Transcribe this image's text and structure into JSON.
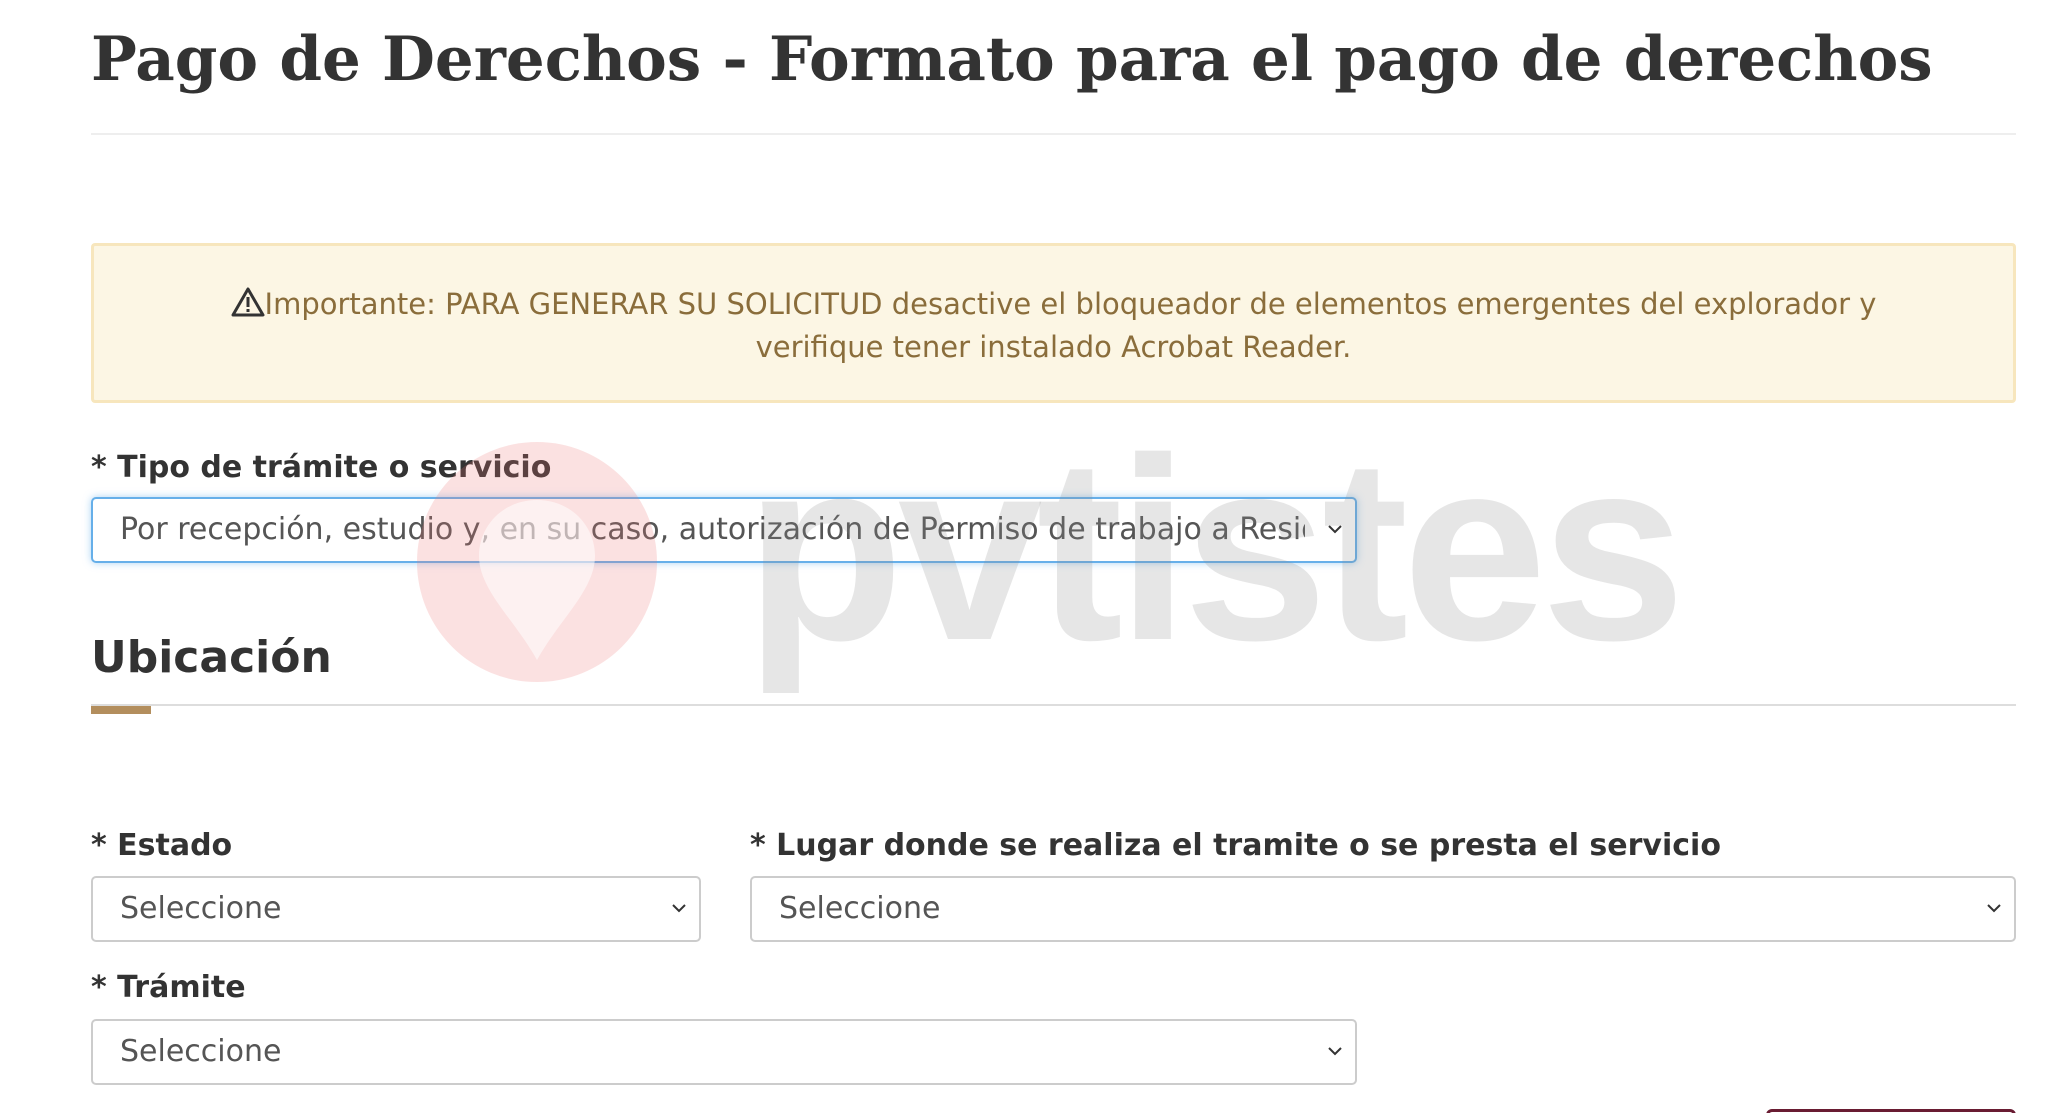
{
  "header": {
    "title": "Pago de Derechos - Formato para el pago de derechos"
  },
  "alert": {
    "icon": "warning-icon",
    "text": "Importante: PARA GENERAR SU SOLICITUD desactive el bloqueador de elementos emergentes del explorador y verifique tener instalado Acrobat Reader."
  },
  "tipo_tramite": {
    "label": "* Tipo de trámite o servicio",
    "value": "Por recepción, estudio y, en su caso, autorización de Permiso de trabajo a Residente Temporal Estudiante"
  },
  "ubicacion": {
    "title": "Ubicación",
    "estado": {
      "label": "* Estado",
      "value": "Seleccione"
    },
    "lugar": {
      "label": "* Lugar donde se realiza el tramite o se presta el servicio",
      "value": "Seleccione"
    },
    "tramite": {
      "label": "* Trámite",
      "value": "Seleccione"
    }
  },
  "watermark": {
    "text": "pvtistes"
  },
  "colors": {
    "alert_background": "#fcf6e4",
    "alert_text": "#8a6d3b",
    "section_accent": "#b38e5d",
    "focus_border": "#66afe9",
    "button_border": "#691c32"
  }
}
